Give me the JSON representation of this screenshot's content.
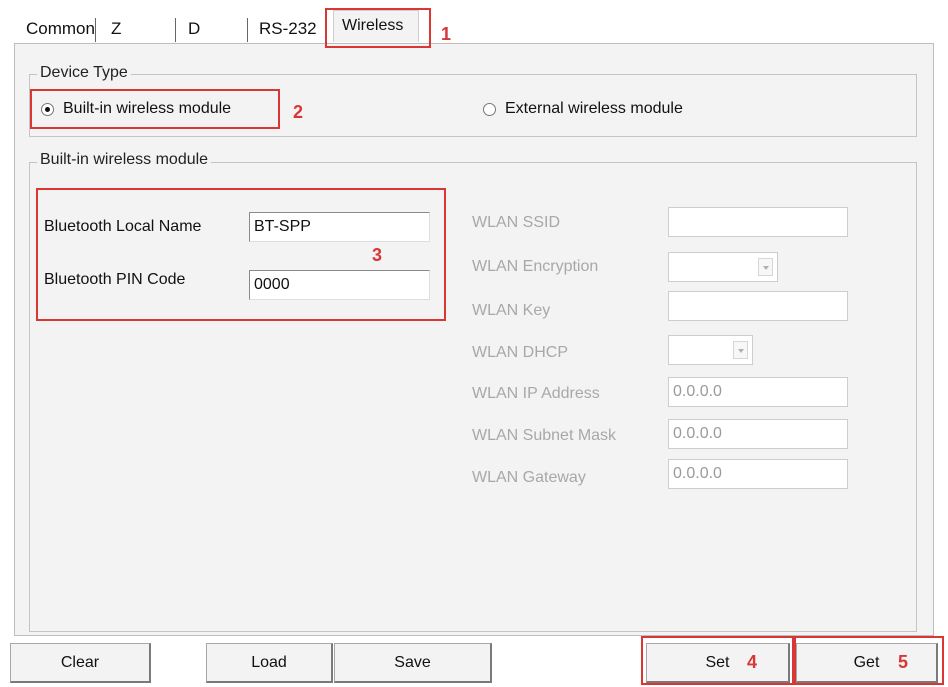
{
  "tabs": {
    "common": "Common",
    "z": "Z",
    "d": "D",
    "rs232": "RS-232",
    "wireless": "Wireless"
  },
  "device_type": {
    "legend": "Device Type",
    "builtin_label": "Built-in wireless module",
    "external_label": "External wireless module",
    "selected": "builtin"
  },
  "builtin_group": {
    "legend": "Built-in wireless module",
    "bt_name_label": "Bluetooth Local Name",
    "bt_name_value": "BT-SPP",
    "bt_pin_label": "Bluetooth PIN Code",
    "bt_pin_value": "0000"
  },
  "wlan": {
    "ssid_label": "WLAN SSID",
    "ssid_value": "",
    "encryption_label": "WLAN Encryption",
    "encryption_value": "",
    "key_label": "WLAN Key",
    "key_value": "",
    "dhcp_label": "WLAN DHCP",
    "dhcp_value": "",
    "ip_label": "WLAN IP Address",
    "ip_value": "0.0.0.0",
    "mask_label": "WLAN Subnet Mask",
    "mask_value": "0.0.0.0",
    "gateway_label": "WLAN Gateway",
    "gateway_value": "0.0.0.0"
  },
  "buttons": {
    "clear": "Clear",
    "load": "Load",
    "save": "Save",
    "set": "Set",
    "get": "Get"
  },
  "annotations": [
    "1",
    "2",
    "3",
    "4",
    "5"
  ],
  "colors": {
    "annotation": "#d93636",
    "panel": "#f3f3f3",
    "disabled_text": "#a8a8a8"
  }
}
